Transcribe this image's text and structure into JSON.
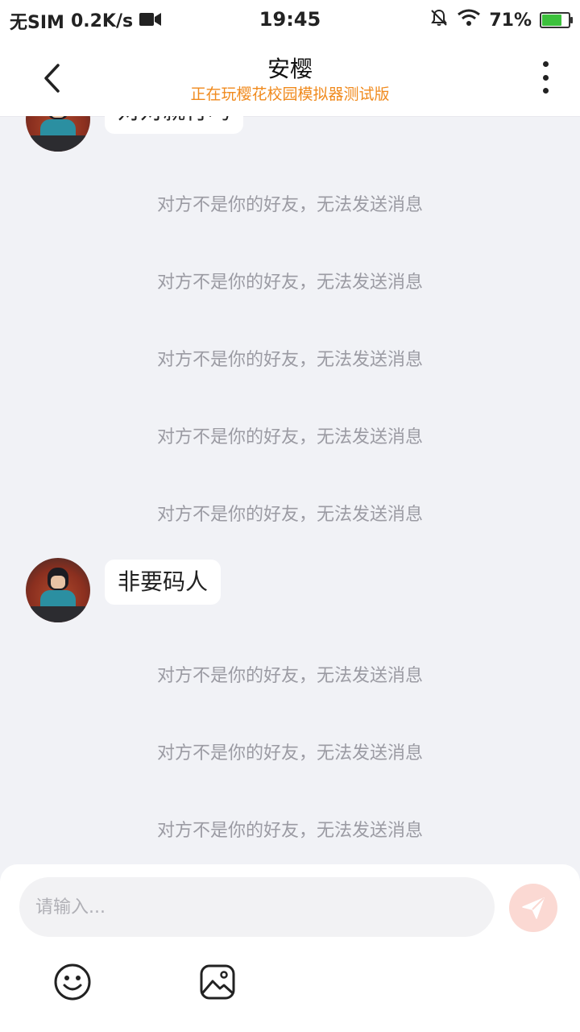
{
  "status_bar": {
    "carrier": "无SIM",
    "speed": "0.2K/s",
    "time": "19:45",
    "battery_percent": "71%",
    "battery_level": 0.71
  },
  "header": {
    "title": "安樱",
    "subtitle": "正在玩樱花校园模拟器测试版"
  },
  "chat": {
    "partial_top_message": "对对就行吗",
    "notices_top": [
      "对方不是你的好友，无法发送消息",
      "对方不是你的好友，无法发送消息",
      "对方不是你的好友，无法发送消息",
      "对方不是你的好友，无法发送消息",
      "对方不是你的好友，无法发送消息"
    ],
    "message": "非要码人",
    "notices_bottom": [
      "对方不是你的好友，无法发送消息",
      "对方不是你的好友，无法发送消息",
      "对方不是你的好友，无法发送消息"
    ]
  },
  "input": {
    "placeholder": "请输入..."
  },
  "colors": {
    "accent": "#f08a1d",
    "background": "#f1f2f6",
    "notice_text": "#9b9ba3",
    "send_button": "#fbd9d3"
  }
}
